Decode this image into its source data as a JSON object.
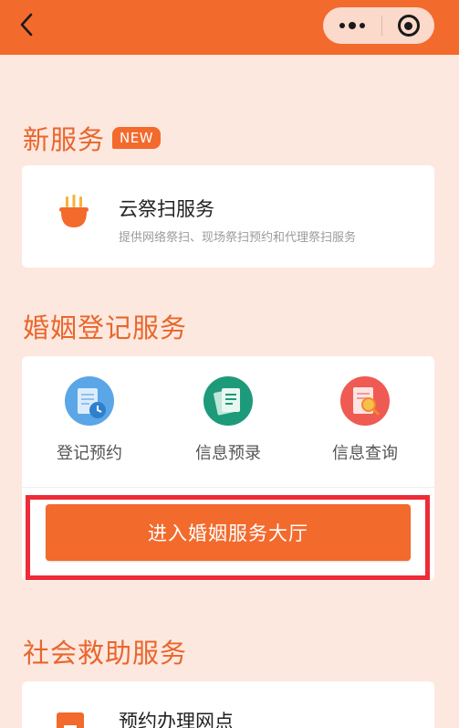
{
  "new_services": {
    "title": "新服务",
    "badge": "NEW",
    "card": {
      "title": "云祭扫服务",
      "description": "提供网络祭扫、现场祭扫预约和代理祭扫服务"
    }
  },
  "marriage": {
    "title": "婚姻登记服务",
    "items": [
      {
        "label": "登记预约",
        "icon": "calendar-clock-icon",
        "color": "#5aa6e6"
      },
      {
        "label": "信息预录",
        "icon": "document-edit-icon",
        "color": "#1d9a7a"
      },
      {
        "label": "信息查询",
        "icon": "document-search-icon",
        "color": "#ef5a52"
      }
    ],
    "enter_button": "进入婚姻服务大厅"
  },
  "rescue": {
    "title": "社会救助服务",
    "card": {
      "title": "预约办理网点"
    }
  },
  "colors": {
    "accent": "#f36a2d",
    "background": "#fde8df",
    "highlight": "#ee2b36"
  }
}
